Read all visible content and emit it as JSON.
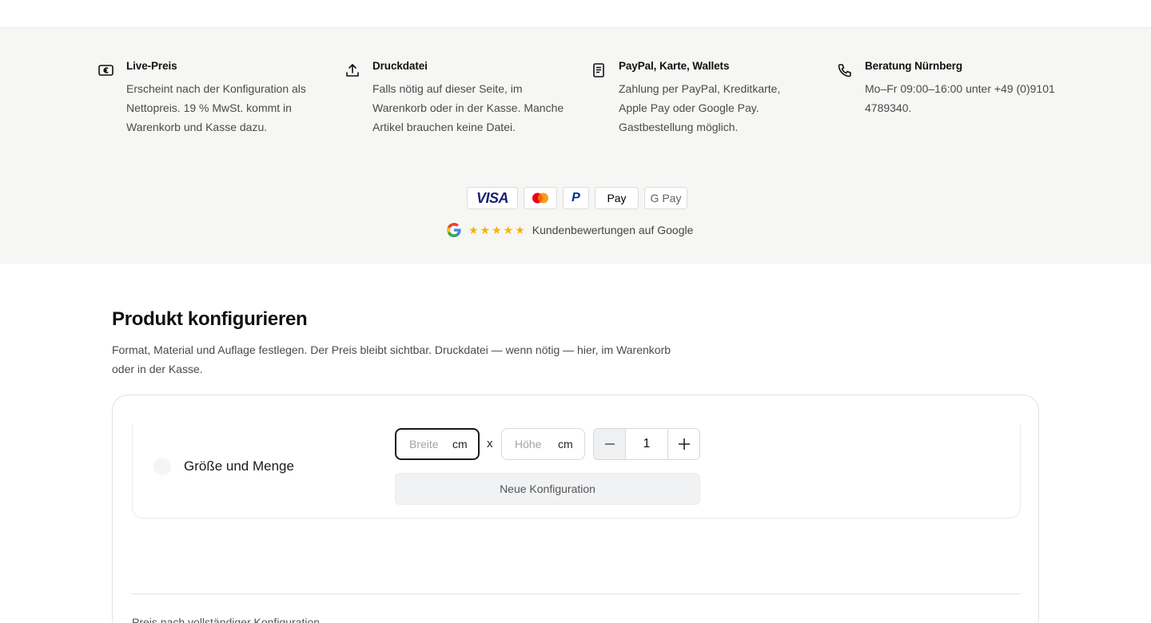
{
  "features": [
    {
      "icon": "euro-icon",
      "title": "Live-Preis",
      "text": "Erscheint nach der Konfiguration als Nettopreis. 19 % MwSt. kommt in Warenkorb und Kasse dazu."
    },
    {
      "icon": "upload-icon",
      "title": "Druckdatei",
      "text": "Falls nötig auf dieser Seite, im Warenkorb oder in der Kasse. Manche Artikel brauchen keine Datei."
    },
    {
      "icon": "receipt-icon",
      "title": "PayPal, Karte, Wallets",
      "text": "Zahlung per PayPal, Kreditkarte, Apple Pay oder Google Pay. Gastbestellung möglich."
    },
    {
      "icon": "phone-icon",
      "title": "Beratung Nürnberg",
      "text": "Mo–Fr 09:00–16:00 unter +49 (0)9101 4789340."
    }
  ],
  "payments": {
    "visa": "VISA",
    "mastercard": "mastercard-logo",
    "paypal": "P",
    "applepay": " Pay",
    "googlepay": "G Pay"
  },
  "rating": {
    "stars": "★★★★★",
    "text": "Kundenbewertungen auf Google"
  },
  "configurator": {
    "title": "Produkt konfigurieren",
    "description": "Format, Material und Auflage festlegen. Der Preis bleibt sichtbar. Druckdatei — wenn nötig — hier, im Warenkorb oder in der Kasse.",
    "row_label": "Größe und Menge",
    "width_placeholder": "Breite",
    "height_placeholder": "Höhe",
    "unit": "cm",
    "times": "x",
    "quantity": "1",
    "new_config_label": "Neue Konfiguration",
    "price_note": "Preis nach vollständiger Konfiguration"
  },
  "colors": {
    "band_bg": "#f6f6f4",
    "star": "#f5b400",
    "visa": "#1a1f71",
    "paypal": "#003087"
  }
}
